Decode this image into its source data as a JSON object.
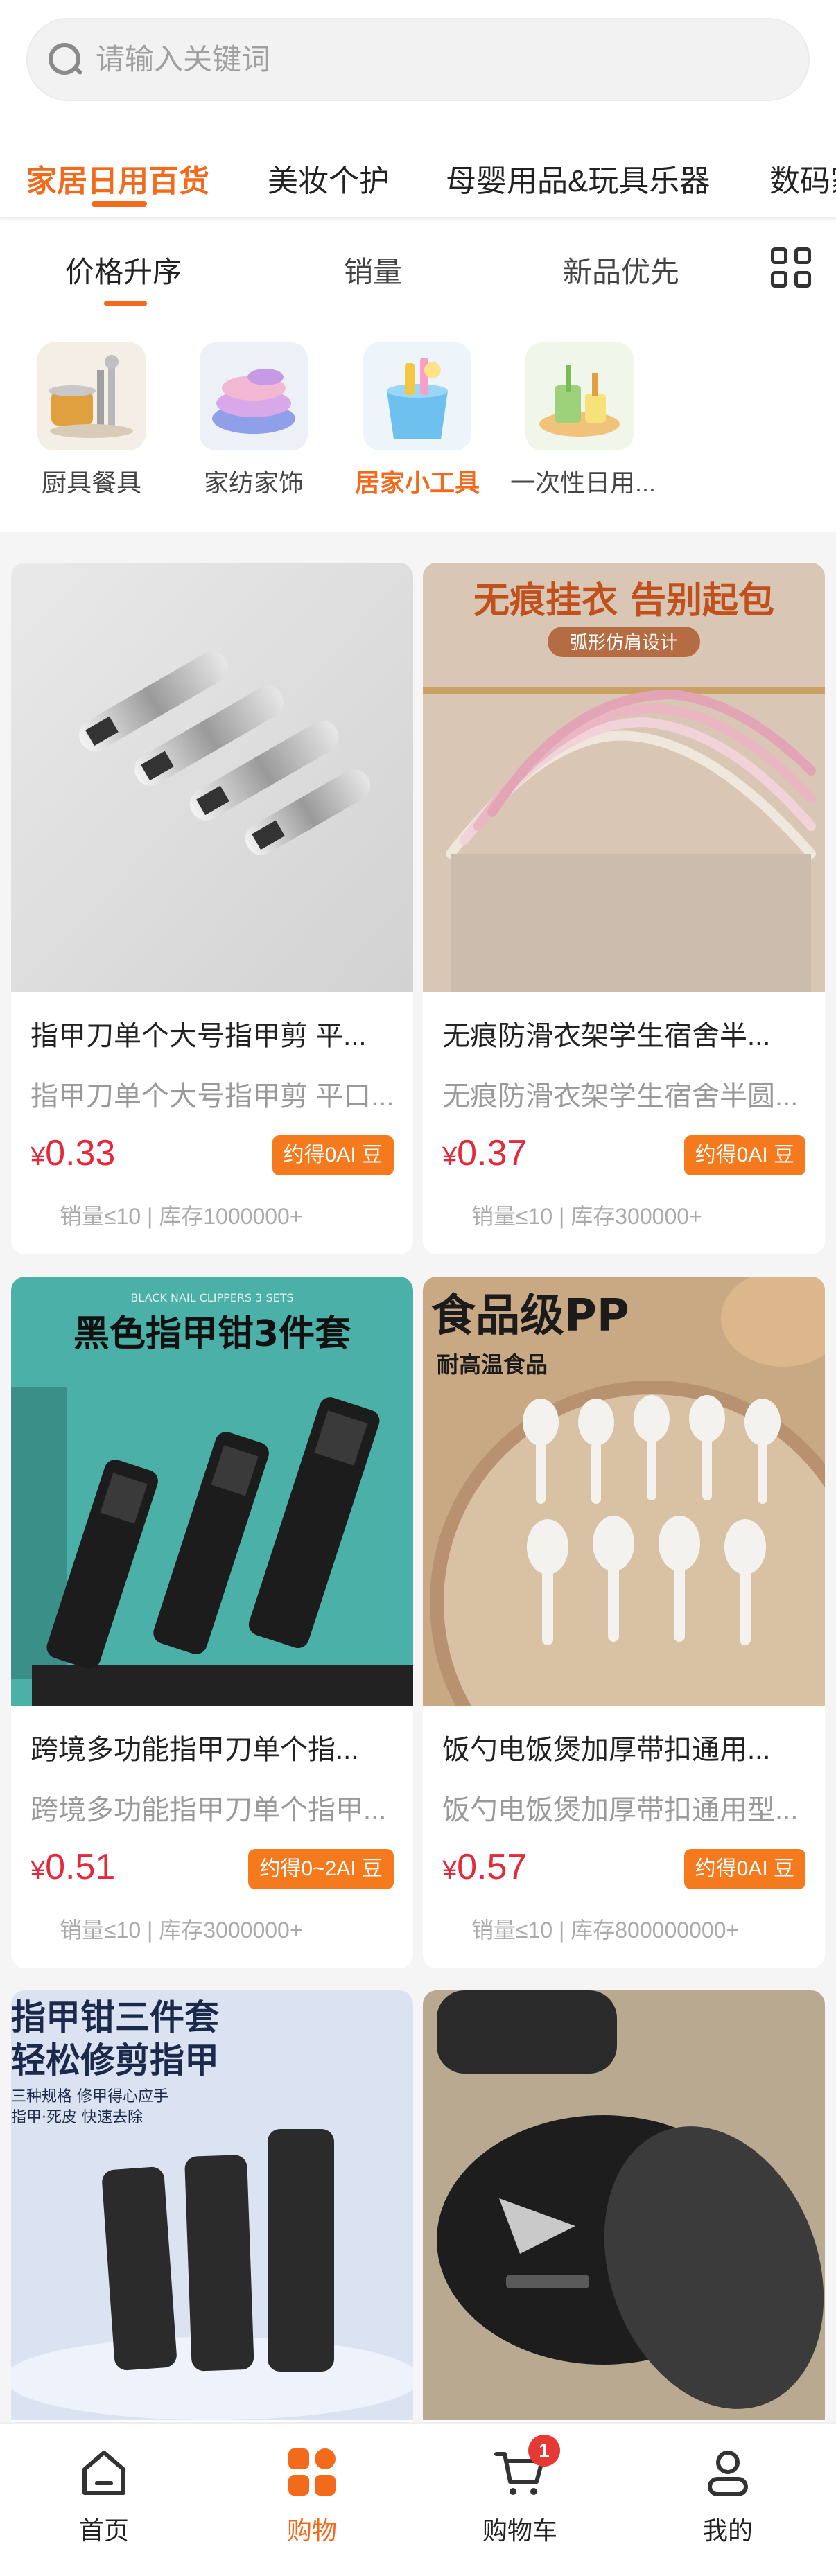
{
  "search": {
    "placeholder": "请输入关键词"
  },
  "category_tabs": [
    {
      "label": "家居日用百货",
      "active": true
    },
    {
      "label": "美妆个护",
      "active": false
    },
    {
      "label": "母婴用品&玩具乐器",
      "active": false
    },
    {
      "label": "数码家电",
      "active": false
    }
  ],
  "sort_bar": [
    {
      "label": "价格升序",
      "active": true
    },
    {
      "label": "销量",
      "active": false
    },
    {
      "label": "新品优先",
      "active": false
    }
  ],
  "sub_categories": [
    {
      "label": "厨具餐具",
      "active": false
    },
    {
      "label": "家纺家饰",
      "active": false
    },
    {
      "label": "居家小工具",
      "active": true
    },
    {
      "label": "一次性日用...",
      "active": false
    }
  ],
  "products": [
    {
      "title": "指甲刀单个大号指甲剪 平...",
      "subtitle": "指甲刀单个大号指甲剪 平口...",
      "currency": "¥",
      "price": "0.33",
      "bean": "约得0AI 豆",
      "sales": "销量≤10 | 库存1000000+",
      "banner": ""
    },
    {
      "title": "无痕防滑衣架学生宿舍半...",
      "subtitle": "无痕防滑衣架学生宿舍半圆...",
      "currency": "¥",
      "price": "0.37",
      "bean": "约得0AI 豆",
      "sales": "销量≤10 | 库存300000+",
      "banner": "无痕挂衣 告别起包",
      "banner_sub": "弧形仿肩设计"
    },
    {
      "title": "跨境多功能指甲刀单个指...",
      "subtitle": "跨境多功能指甲刀单个指甲...",
      "currency": "¥",
      "price": "0.51",
      "bean": "约得0~2AI 豆",
      "sales": "销量≤10 | 库存3000000+",
      "banner": "黑色指甲钳3件套",
      "banner_sub": "BLACK NAIL CLIPPERS 3 SETS"
    },
    {
      "title": "饭勺电饭煲加厚带扣通用...",
      "subtitle": "饭勺电饭煲加厚带扣通用型...",
      "currency": "¥",
      "price": "0.57",
      "bean": "约得0AI 豆",
      "sales": "销量≤10 | 库存800000000+",
      "banner": "食品级PP",
      "banner_sub": "耐高温食品"
    },
    {
      "banner": "指甲钳三件套",
      "banner_sub": "轻松修剪指甲",
      "banner_lines": [
        "三种规格 修甲得心应手",
        "指甲·死皮 快速去除"
      ]
    },
    {
      "banner": ""
    }
  ],
  "bottom_nav": [
    {
      "label": "首页",
      "icon": "home-icon",
      "active": false
    },
    {
      "label": "购物",
      "icon": "shop-grid-icon",
      "active": true
    },
    {
      "label": "购物车",
      "icon": "cart-icon",
      "active": false,
      "badge": "1"
    },
    {
      "label": "我的",
      "icon": "user-icon",
      "active": false
    }
  ],
  "colors": {
    "accent": "#f26a1b",
    "price": "#e4293a",
    "bean_bg": "#f47a1d"
  }
}
